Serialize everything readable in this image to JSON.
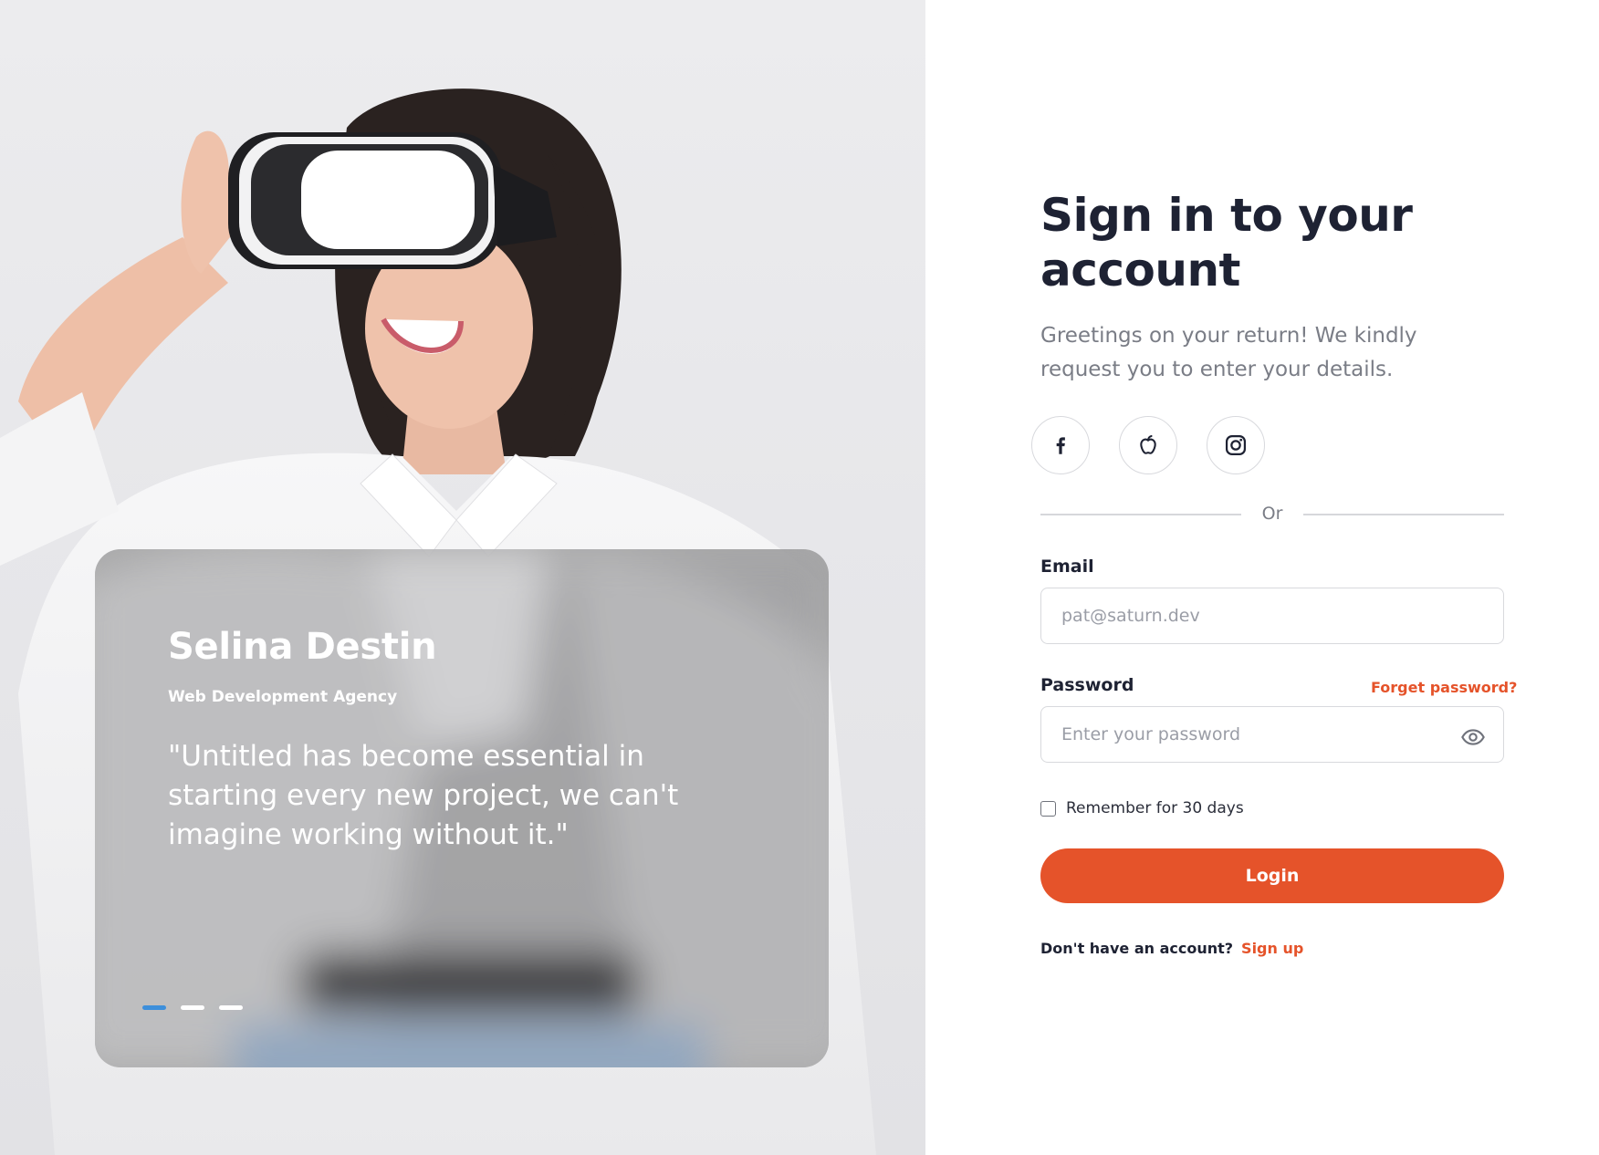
{
  "hero": {
    "testimonial": {
      "name": "Selina Destin",
      "role": "Web Development Agency",
      "quote": "\"Untitled has become essential in starting every new project, we can't imagine working without it.\""
    },
    "carousel": {
      "count": 3,
      "active_index": 0
    }
  },
  "form": {
    "title": "Sign in to your account",
    "subtitle": "Greetings on your return! We kindly request you to enter your details.",
    "social": [
      {
        "icon": "facebook-icon"
      },
      {
        "icon": "apple-icon"
      },
      {
        "icon": "instagram-icon"
      }
    ],
    "divider_text": "Or",
    "email": {
      "label": "Email",
      "placeholder": "pat@saturn.dev"
    },
    "password": {
      "label": "Password",
      "placeholder": "Enter your password",
      "forgot_label": "Forget password?"
    },
    "remember_label": "Remember for 30 days",
    "remember_checked": false,
    "login_label": "Login",
    "signup_prompt": "Don't have an account?",
    "signup_link": "Sign up"
  },
  "colors": {
    "accent": "#e5532a",
    "heading": "#1e2233",
    "muted": "#7a7d86",
    "carousel_active": "#3d8fdb"
  }
}
